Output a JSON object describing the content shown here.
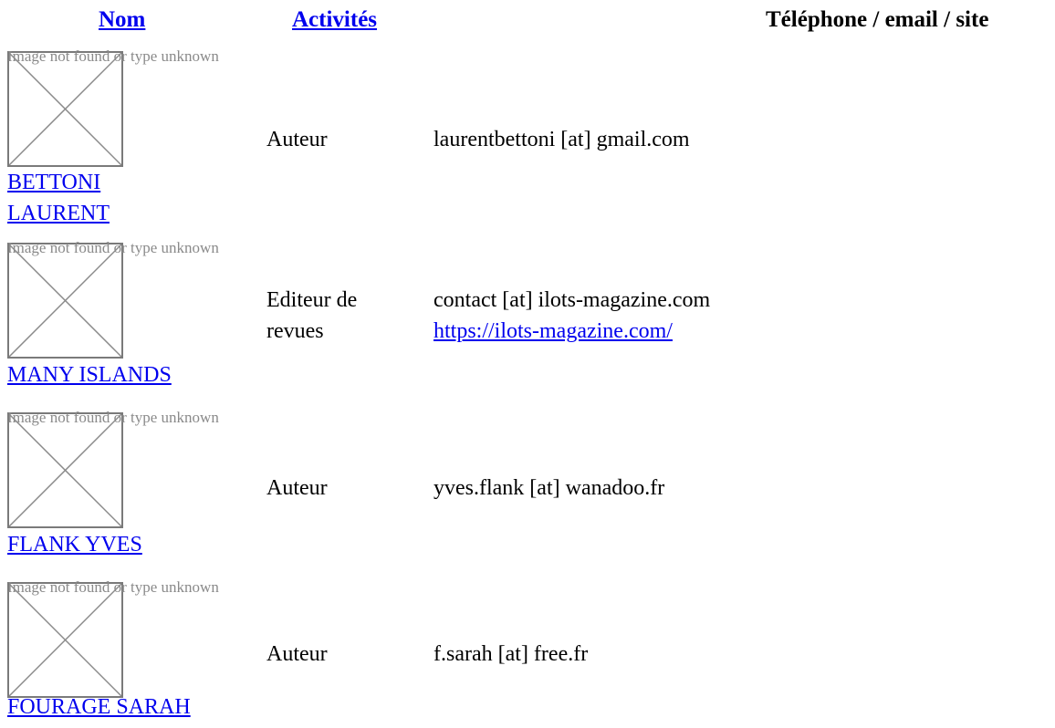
{
  "header": {
    "nom": "Nom",
    "activites": "Activités",
    "contact": "Téléphone / email / site"
  },
  "broken_image_alt": "Image not found or type unknown",
  "rows": [
    {
      "name": "BETTONI LAURENT",
      "name_line1": "BETTONI",
      "name_line2": "LAURENT",
      "activity_line1": "Auteur",
      "activity_line2": "",
      "contact_line1": "laurentbettoni [at] gmail.com",
      "contact_link": ""
    },
    {
      "name": "MANY ISLANDS",
      "name_line1": "MANY ISLANDS",
      "name_line2": "",
      "activity_line1": "Editeur de",
      "activity_line2": "revues",
      "contact_line1": "contact [at] ilots-magazine.com",
      "contact_link": "https://ilots-magazine.com/"
    },
    {
      "name": "FLANK YVES",
      "name_line1": "FLANK YVES",
      "name_line2": "",
      "activity_line1": "Auteur",
      "activity_line2": "",
      "contact_line1": "yves.flank [at] wanadoo.fr",
      "contact_link": ""
    },
    {
      "name": "FOURAGE SARAH",
      "name_line1": "FOURAGE SARAH",
      "name_line2": "",
      "activity_line1": "Auteur",
      "activity_line2": "",
      "contact_line1": "f.sarah [at] free.fr",
      "contact_link": ""
    }
  ]
}
